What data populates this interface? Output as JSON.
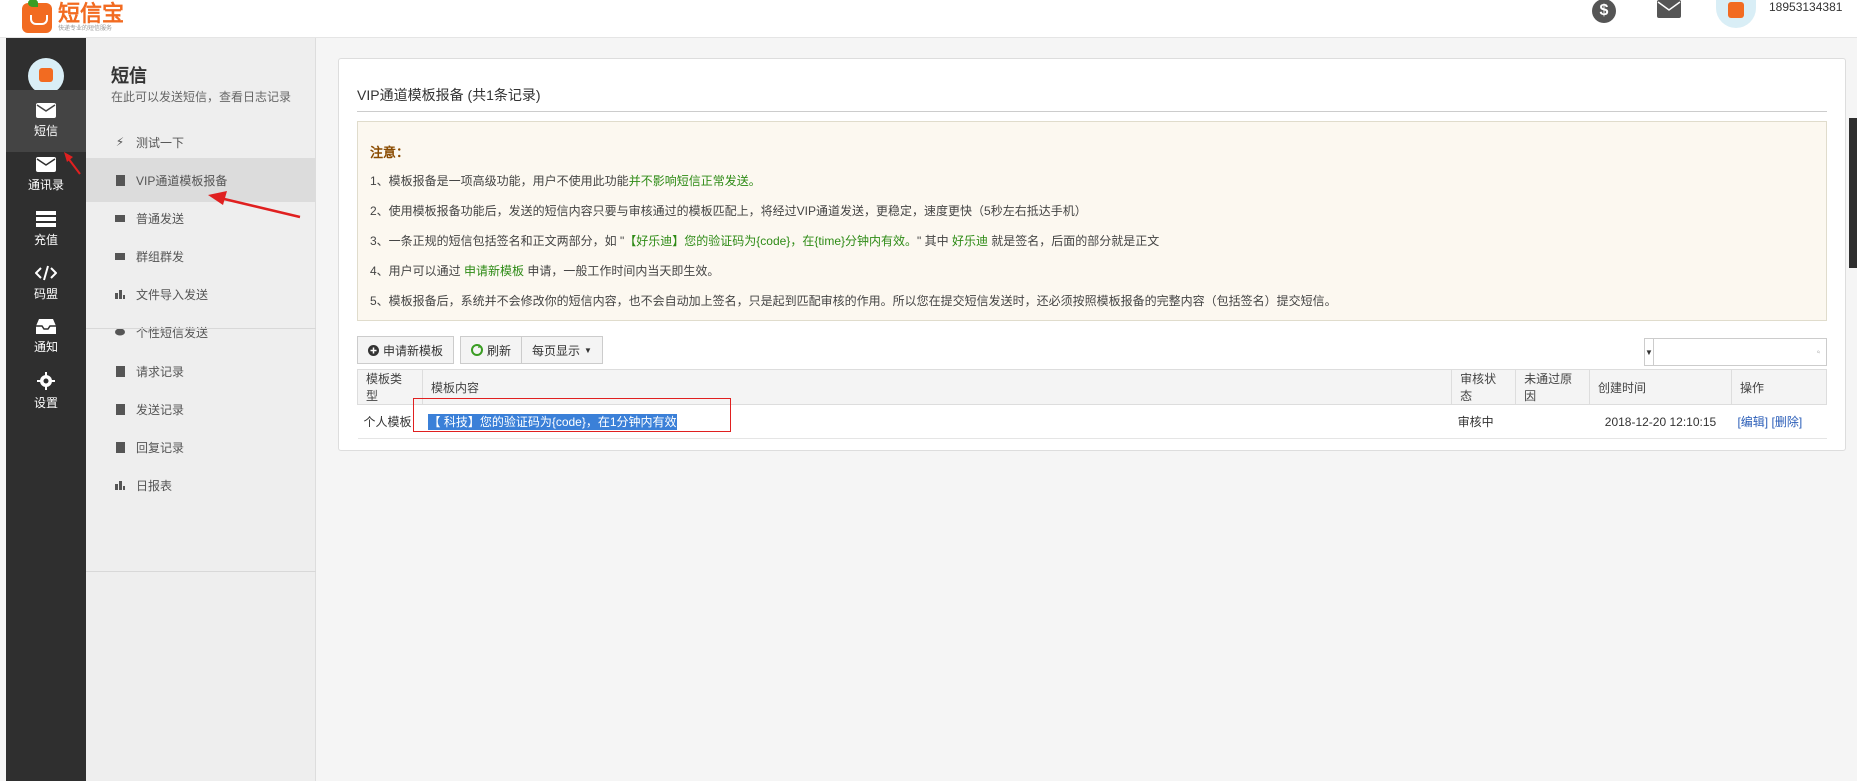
{
  "header": {
    "logo_title": "短信宝",
    "logo_sub": "快递专业的短信服务",
    "phone": "18953134381",
    "dollar_symbol": "$"
  },
  "leftnav": [
    {
      "label": "短信",
      "icon": "mail-icon"
    },
    {
      "label": "通讯录",
      "icon": "contacts-icon"
    },
    {
      "label": "充值",
      "icon": "recharge-icon"
    },
    {
      "label": "码盟",
      "icon": "code-icon"
    },
    {
      "label": "通知",
      "icon": "inbox-icon"
    },
    {
      "label": "设置",
      "icon": "gear-icon"
    }
  ],
  "subnav": {
    "title": "短信",
    "desc": "在此可以发送短信，查看日志记录",
    "items": [
      {
        "label": "测试一下",
        "icon": "bolt-icon"
      },
      {
        "label": "VIP通道模板报备",
        "icon": "book-icon"
      },
      {
        "label": "普通发送",
        "icon": "mail-icon"
      },
      {
        "label": "群组群发",
        "icon": "mail-icon"
      },
      {
        "label": "文件导入发送",
        "icon": "chart-icon"
      },
      {
        "label": "个性短信发送",
        "icon": "comment-icon"
      },
      {
        "label": "请求记录",
        "icon": "book-icon"
      },
      {
        "label": "发送记录",
        "icon": "book-icon"
      },
      {
        "label": "回复记录",
        "icon": "book-icon"
      },
      {
        "label": "日报表",
        "icon": "chart-icon"
      }
    ]
  },
  "panel": {
    "title": "VIP通道模板报备 (共1条记录)",
    "notice_head": "注意：",
    "notice": {
      "l1a": "1、模板报备是一项高级功能，用户不使用此功能",
      "l1b": "并不影响短信正常发送。",
      "l2": "2、使用模板报备功能后，发送的短信内容只要与审核通过的模板匹配上，将经过VIP通道发送，更稳定，速度更快（5秒左右抵达手机）",
      "l3a": "3、一条正规的短信包括签名和正文两部分，如 \"",
      "l3b": "【好乐迪】您的验证码为{code}，在{time}分钟内有效。",
      "l3c": "\" 其中 ",
      "l3d": "好乐迪",
      "l3e": " 就是签名，后面的部分就是正文",
      "l4a": "4、用户可以通过 ",
      "l4b": "申请新模板",
      "l4c": " 申请，一般工作时间内当天即生效。",
      "l5": "5、模板报备后，系统并不会修改你的短信内容，也不会自动加上签名，只是起到匹配审核的作用。所以您在提交短信发送时，还必须按照模板报备的完整内容（包括签名）提交短信。"
    },
    "buttons": {
      "apply": "申请新模板",
      "refresh": "刷新",
      "per_page": "每页显示"
    },
    "search_placeholder": "",
    "table": {
      "headers": [
        "模板类型",
        "模板内容",
        "审核状态",
        "未通过原因",
        "创建时间",
        "操作"
      ],
      "rows": [
        {
          "type": "个人模板",
          "content": "【     科技】您的验证码为{code}，在1分钟内有效",
          "status": "审核中",
          "reason": "",
          "created": "2018-12-20 12:10:15",
          "edit": "[编辑]",
          "delete": "[删除]"
        }
      ]
    }
  },
  "colors": {
    "brand": "#f26b21",
    "nav_bg": "#2f2f2f",
    "notice_green": "#2e8b16",
    "annotation_red": "#e02020"
  }
}
